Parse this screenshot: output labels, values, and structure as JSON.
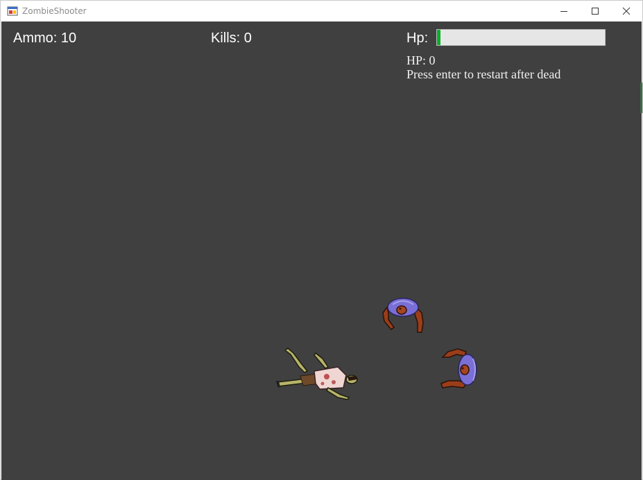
{
  "window": {
    "title": "ZombieShooter",
    "icon": "app-window-icon",
    "controls": [
      "minimize-icon",
      "maximize-icon",
      "close-icon"
    ]
  },
  "hud": {
    "ammo_text": "Ammo: 10",
    "kills_text": "Kills: 0",
    "hp_label": "Hp:",
    "hp_bar_fraction": 0.02,
    "hp_status_text": "HP: 0",
    "restart_hint": "Press enter to restart after dead"
  },
  "colors": {
    "game_background": "#404040",
    "hp_bar_fill": "#06b025",
    "hp_bar_track": "#e6e6e6",
    "zombie_shirt": "#7a6fd6",
    "zombie_skin": "#9a3e1a",
    "player_shirt": "#f0d6d2",
    "player_skin": "#b7b46a"
  },
  "sprites": [
    {
      "name": "dead-player-sprite",
      "state": "dead"
    },
    {
      "name": "zombie-sprite",
      "state": "walking"
    },
    {
      "name": "zombie-sprite",
      "state": "walking"
    }
  ]
}
